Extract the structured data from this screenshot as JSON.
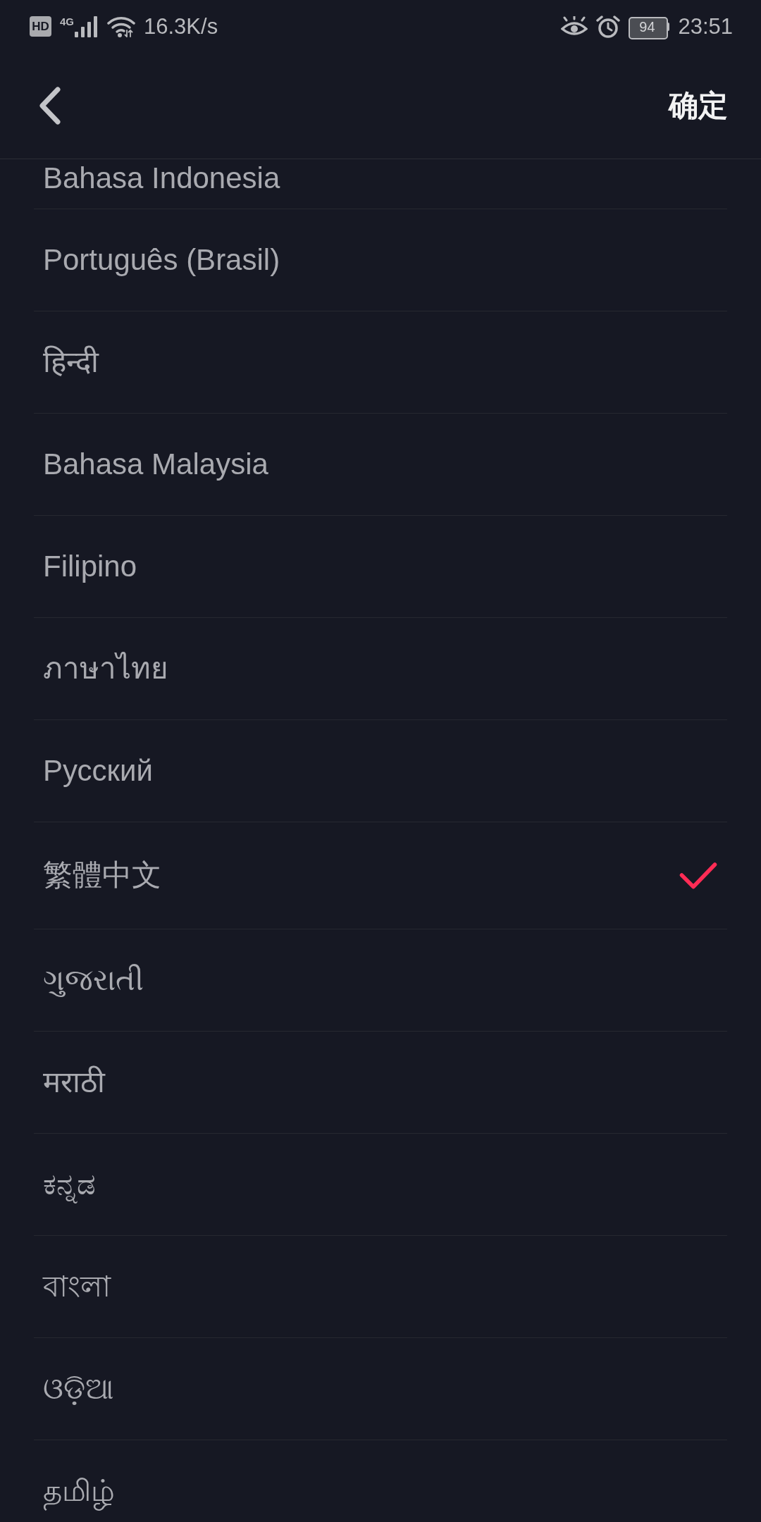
{
  "status_bar": {
    "hd_badge": "HD",
    "network_type": "4G",
    "network_speed": "16.3K/s",
    "battery": "94",
    "time": "23:51"
  },
  "header": {
    "confirm_label": "确定"
  },
  "languages": [
    {
      "label": "Bahasa Indonesia",
      "selected": false
    },
    {
      "label": "Português (Brasil)",
      "selected": false
    },
    {
      "label": "हिन्दी",
      "selected": false
    },
    {
      "label": "Bahasa Malaysia",
      "selected": false
    },
    {
      "label": "Filipino",
      "selected": false
    },
    {
      "label": "ภาษาไทย",
      "selected": false
    },
    {
      "label": "Русский",
      "selected": false
    },
    {
      "label": "繁體中文",
      "selected": true
    },
    {
      "label": "ગુજરાતી",
      "selected": false
    },
    {
      "label": "मराठी",
      "selected": false
    },
    {
      "label": "ಕನ್ನಡ",
      "selected": false
    },
    {
      "label": "বাংলা",
      "selected": false
    },
    {
      "label": "ଓଡ଼ିଆ",
      "selected": false
    },
    {
      "label": "தமிழ்",
      "selected": false
    }
  ]
}
